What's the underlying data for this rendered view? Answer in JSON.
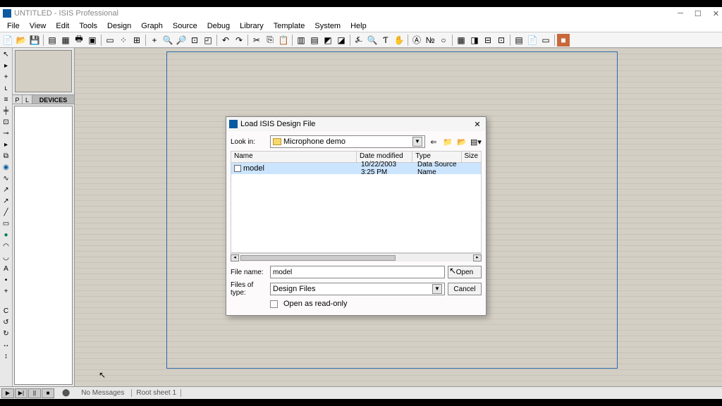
{
  "title": "UNTITLED - ISIS Professional",
  "menu": [
    "File",
    "View",
    "Edit",
    "Tools",
    "Design",
    "Graph",
    "Source",
    "Debug",
    "Library",
    "Template",
    "System",
    "Help"
  ],
  "toolbar_icons": [
    "new-file",
    "open-file",
    "save",
    "sheet",
    "import",
    "print",
    "region",
    "marker",
    "grid-dots",
    "grid-lines",
    "origin",
    "zoom-in",
    "zoom-out",
    "zoom-fit",
    "zoom-area",
    "undo",
    "redo",
    "cut",
    "copy",
    "paste",
    "block-copy",
    "block-move",
    "block-rotate",
    "block-delete",
    "wire-auto",
    "search",
    "text-search",
    "pick",
    "netlist",
    "erc",
    "materials",
    "arena",
    "new-net",
    "report",
    "net-compare",
    "stop"
  ],
  "left_tools": [
    "select",
    "component",
    "junction",
    "label",
    "text-script",
    "bus",
    "subcircuit",
    "terminal",
    "pin",
    "graph-mode",
    "tape",
    "generator",
    "probe-v",
    "probe-i",
    "line",
    "box-line",
    "circle",
    "arc",
    "path",
    "text",
    "symbol",
    "plus-marker",
    "refresh",
    "rotate-ccw",
    "rotate-cw",
    "mirror-h",
    "mirror-v"
  ],
  "panel": {
    "p": "P",
    "l": "L",
    "devices": "DEVICES"
  },
  "status": {
    "no_msg": "No Messages",
    "sheet": "Root sheet 1"
  },
  "dialog": {
    "title": "Load ISIS Design File",
    "look_in_label": "Look in:",
    "look_in_value": "Microphone demo",
    "columns": {
      "name": "Name",
      "date": "Date modified",
      "type": "Type",
      "size": "Size"
    },
    "file": {
      "name": "model",
      "date": "10/22/2003 3:25 PM",
      "type": "Data Source Name"
    },
    "filename_label": "File name:",
    "filename_value": "model",
    "filetype_label": "Files of type:",
    "filetype_value": "Design Files",
    "readonly": "Open as read-only",
    "open_btn": "Open",
    "cancel_btn": "Cancel"
  }
}
